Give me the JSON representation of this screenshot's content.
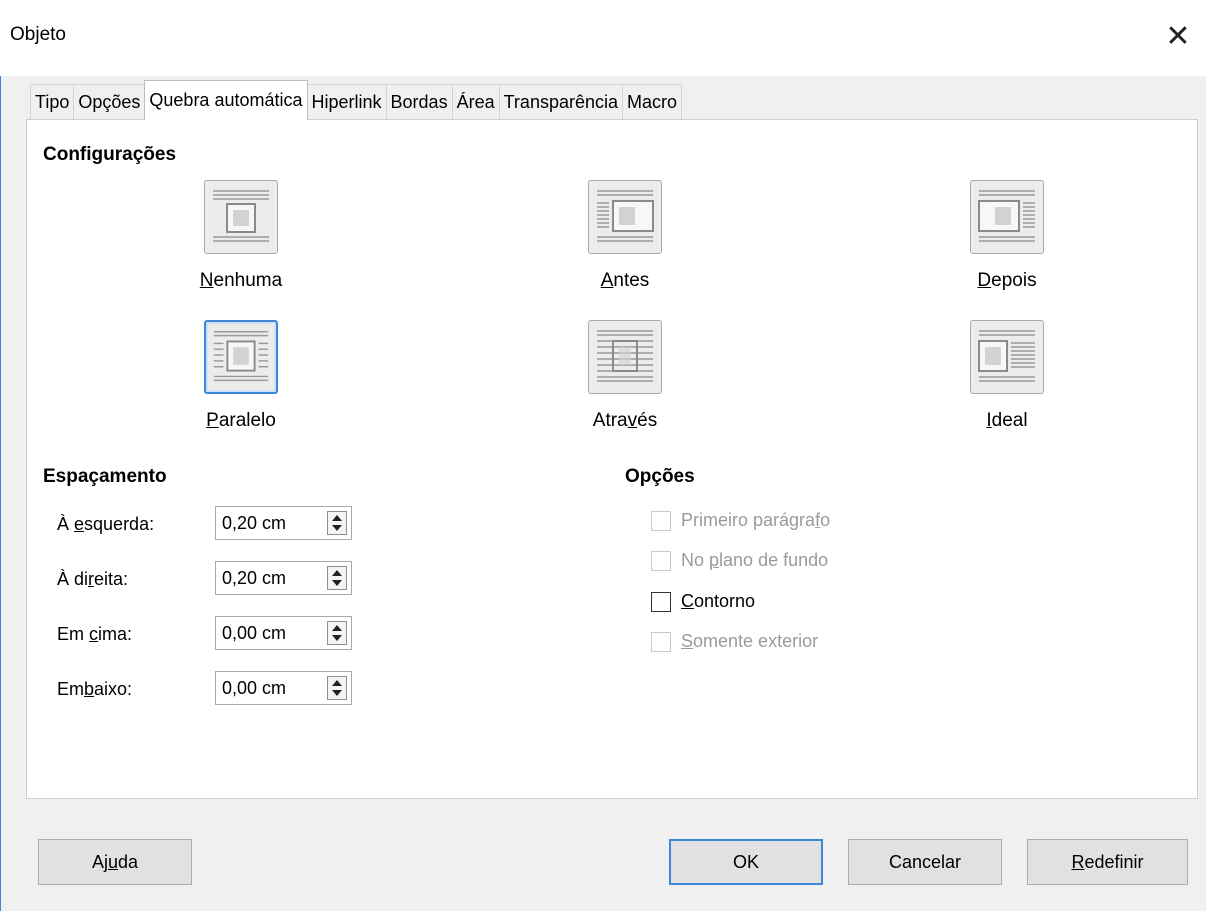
{
  "window": {
    "title": "Objeto",
    "close_glyph": "✕"
  },
  "tabs": [
    {
      "label": "Tipo"
    },
    {
      "label": "Opções"
    },
    {
      "label": "Quebra automática",
      "active": true
    },
    {
      "label": "Hiperlink"
    },
    {
      "label": "Bordas"
    },
    {
      "label": "Área"
    },
    {
      "label": "Transparência"
    },
    {
      "label": "Macro"
    }
  ],
  "settings": {
    "title": "Configurações",
    "options": [
      {
        "name": "none",
        "label_pre": "",
        "label_u": "N",
        "label_post": "enhuma"
      },
      {
        "name": "before",
        "label_pre": "",
        "label_u": "A",
        "label_post": "ntes"
      },
      {
        "name": "after",
        "label_pre": "",
        "label_u": "D",
        "label_post": "epois"
      },
      {
        "name": "parallel",
        "label_pre": "",
        "label_u": "P",
        "label_post": "aralelo",
        "selected": true
      },
      {
        "name": "through",
        "label_pre": "Atra",
        "label_u": "v",
        "label_post": "és"
      },
      {
        "name": "ideal",
        "label_pre": "",
        "label_u": "I",
        "label_post": "deal"
      }
    ]
  },
  "spacing": {
    "title": "Espaçamento",
    "fields": [
      {
        "label_pre": "À ",
        "label_u": "e",
        "label_post": "squerda:",
        "value": "0,20 cm"
      },
      {
        "label_pre": "À di",
        "label_u": "r",
        "label_post": "eita:",
        "value": "0,20 cm"
      },
      {
        "label_pre": "Em ",
        "label_u": "c",
        "label_post": "ima:",
        "value": "0,00 cm"
      },
      {
        "label_pre": "Em",
        "label_u": "b",
        "label_post": "aixo:",
        "value": "0,00 cm"
      }
    ]
  },
  "options": {
    "title": "Opções",
    "items": [
      {
        "label_pre": "Primeiro parágra",
        "label_u": "f",
        "label_post": "o",
        "checked": false,
        "disabled": true
      },
      {
        "label_pre": "No ",
        "label_u": "p",
        "label_post": "lano de fundo",
        "checked": false,
        "disabled": true
      },
      {
        "label_pre": "",
        "label_u": "C",
        "label_post": "ontorno",
        "checked": false,
        "disabled": false
      },
      {
        "label_pre": "",
        "label_u": "S",
        "label_post": "omente exterior",
        "checked": false,
        "disabled": true
      }
    ]
  },
  "buttons": {
    "help": {
      "label_pre": "Aj",
      "label_u": "u",
      "label_post": "da"
    },
    "ok": {
      "label": "OK"
    },
    "cancel": {
      "label": "Cancelar"
    },
    "reset": {
      "label_pre": "",
      "label_u": "R",
      "label_post": "edefinir"
    }
  },
  "colors": {
    "accent": "#3c87d8",
    "dialog_bg": "#f0f0f0",
    "panel_bg": "#ffffff"
  }
}
